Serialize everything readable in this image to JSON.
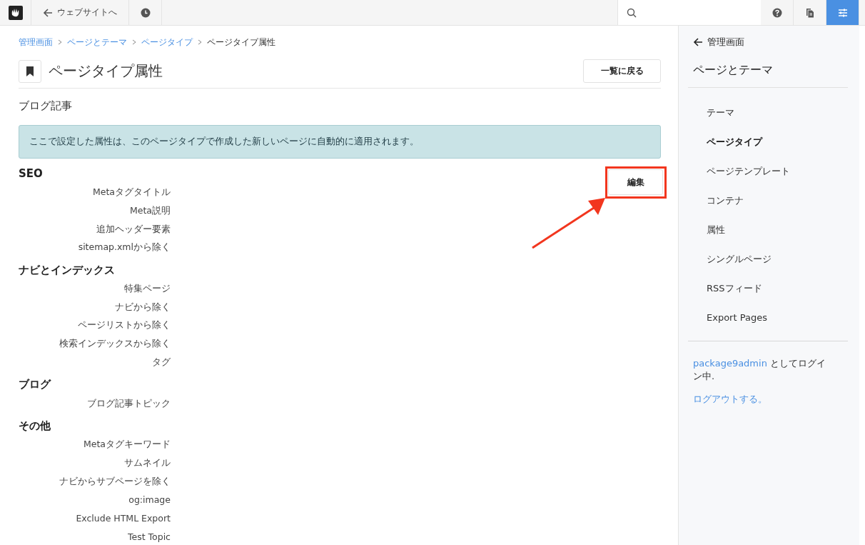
{
  "topbar": {
    "back_label": "ウェブサイトへ",
    "settings_selected": true
  },
  "breadcrumb": [
    {
      "label": "管理画面",
      "link": true
    },
    {
      "label": "ページとテーマ",
      "link": true
    },
    {
      "label": "ページタイプ",
      "link": true
    },
    {
      "label": "ページタイプ属性",
      "link": false
    }
  ],
  "page_title": "ページタイプ属性",
  "back_button": "一覧に戻る",
  "subtitle": "ブログ記事",
  "alert": "ここで設定した属性は、このページタイプで作成した新しいページに自動的に適用されます。",
  "edit_button": "編集",
  "groups": [
    {
      "heading": "SEO",
      "attributes": [
        "Metaタグタイトル",
        "Meta説明",
        "追加ヘッダー要素",
        "sitemap.xmlから除く"
      ]
    },
    {
      "heading": "ナビとインデックス",
      "attributes": [
        "特集ページ",
        "ナビから除く",
        "ページリストから除く",
        "検索インデックスから除く",
        "タグ"
      ]
    },
    {
      "heading": "ブログ",
      "attributes": [
        "ブログ記事トピック"
      ]
    },
    {
      "heading": "その他",
      "attributes": [
        "Metaタグキーワード",
        "サムネイル",
        "ナビからサブページを除く",
        "og:image",
        "Exclude HTML Export",
        "Test Topic"
      ]
    }
  ],
  "sidebar": {
    "back_link": "管理画面",
    "heading": "ページとテーマ",
    "items": [
      {
        "label": "テーマ",
        "selected": false
      },
      {
        "label": "ページタイプ",
        "selected": true
      },
      {
        "label": "ページテンプレート",
        "selected": false
      },
      {
        "label": "コンテナ",
        "selected": false
      },
      {
        "label": "属性",
        "selected": false
      },
      {
        "label": "シングルページ",
        "selected": false
      },
      {
        "label": "RSSフィード",
        "selected": false
      },
      {
        "label": "Export Pages",
        "selected": false
      }
    ],
    "login_user": "package9admin",
    "login_suffix": "としてログイン中.",
    "logout": "ログアウトする。"
  }
}
